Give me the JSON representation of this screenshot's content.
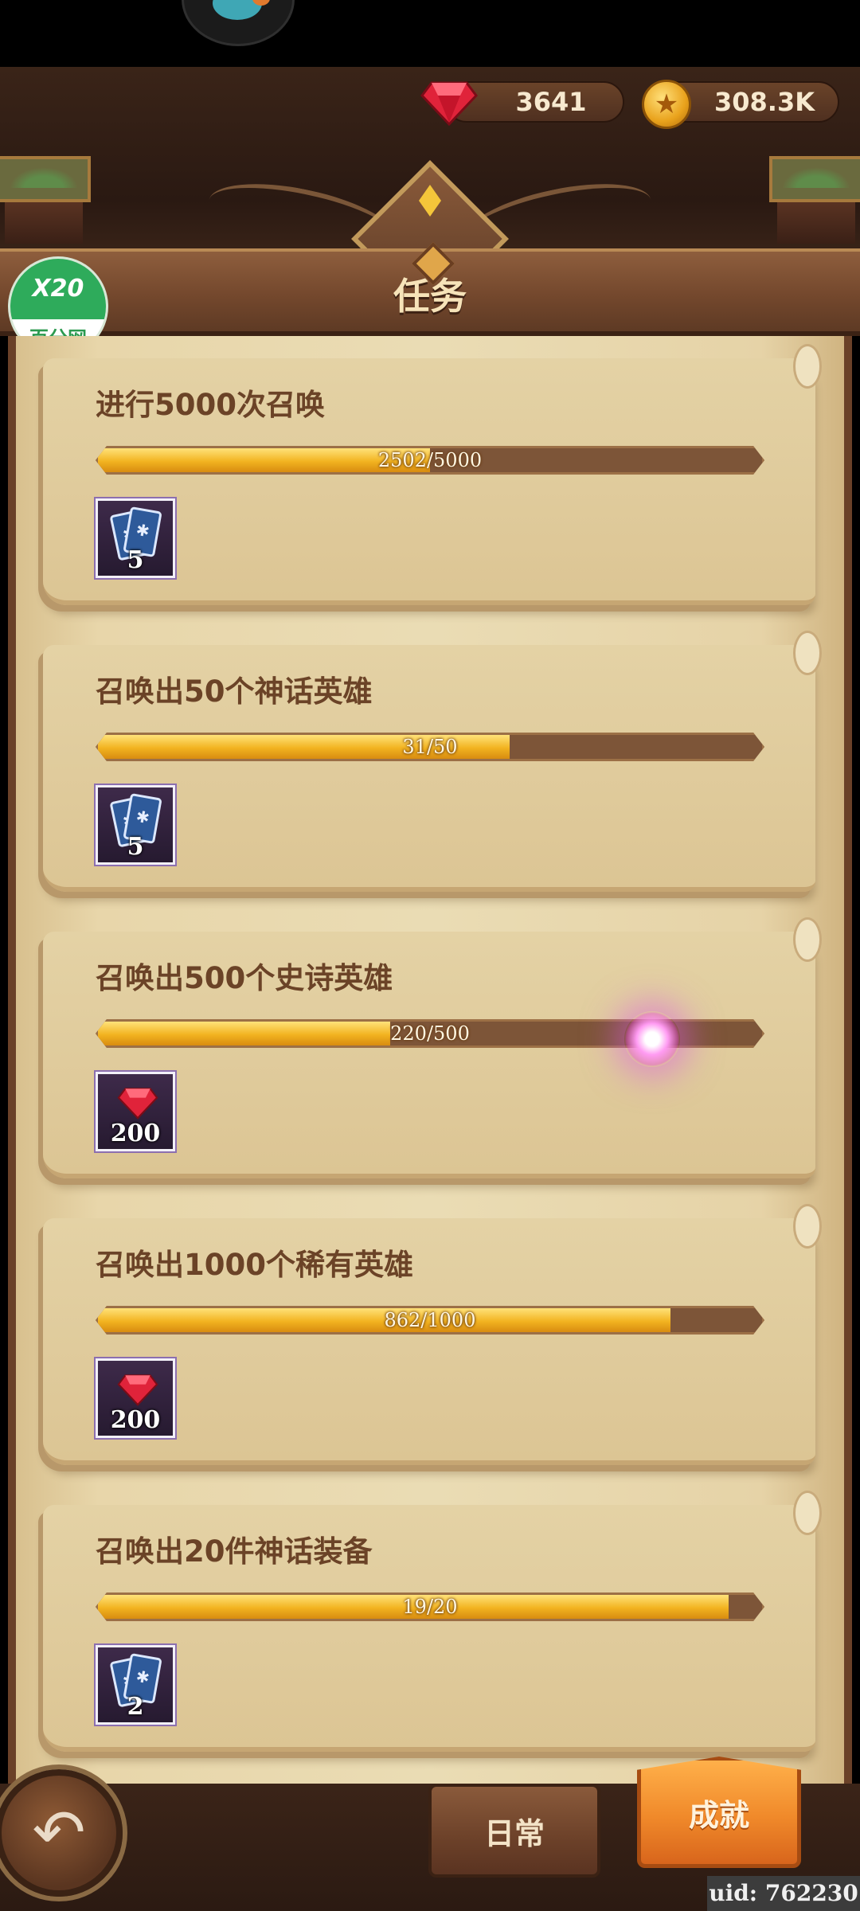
{
  "header": {
    "title": "任务",
    "currencies": {
      "gems": "3641",
      "gold": "308.3K"
    }
  },
  "watermark": {
    "top": "X20",
    "bottom": "百分网"
  },
  "tasks": [
    {
      "title": "进行5000次召唤",
      "progress_text": "2502/5000",
      "progress": 0.5004,
      "reward_type": "card",
      "reward_count": "5"
    },
    {
      "title": "召唤出50个神话英雄",
      "progress_text": "31/50",
      "progress": 0.62,
      "reward_type": "card",
      "reward_count": "5"
    },
    {
      "title": "召唤出500个史诗英雄",
      "progress_text": "220/500",
      "progress": 0.44,
      "reward_type": "gem",
      "reward_count": "200"
    },
    {
      "title": "召唤出1000个稀有英雄",
      "progress_text": "862/1000",
      "progress": 0.862,
      "reward_type": "gem",
      "reward_count": "200"
    },
    {
      "title": "召唤出20件神话装备",
      "progress_text": "19/20",
      "progress": 0.95,
      "reward_type": "card",
      "reward_count": "2"
    }
  ],
  "bottom": {
    "tab_daily": "日常",
    "tab_achievement": "成就",
    "uid": "uid: 762230"
  },
  "colors": {
    "progress_fill": "#f2b320",
    "active_tab": "#f0892a",
    "title_text": "#6b4327"
  }
}
